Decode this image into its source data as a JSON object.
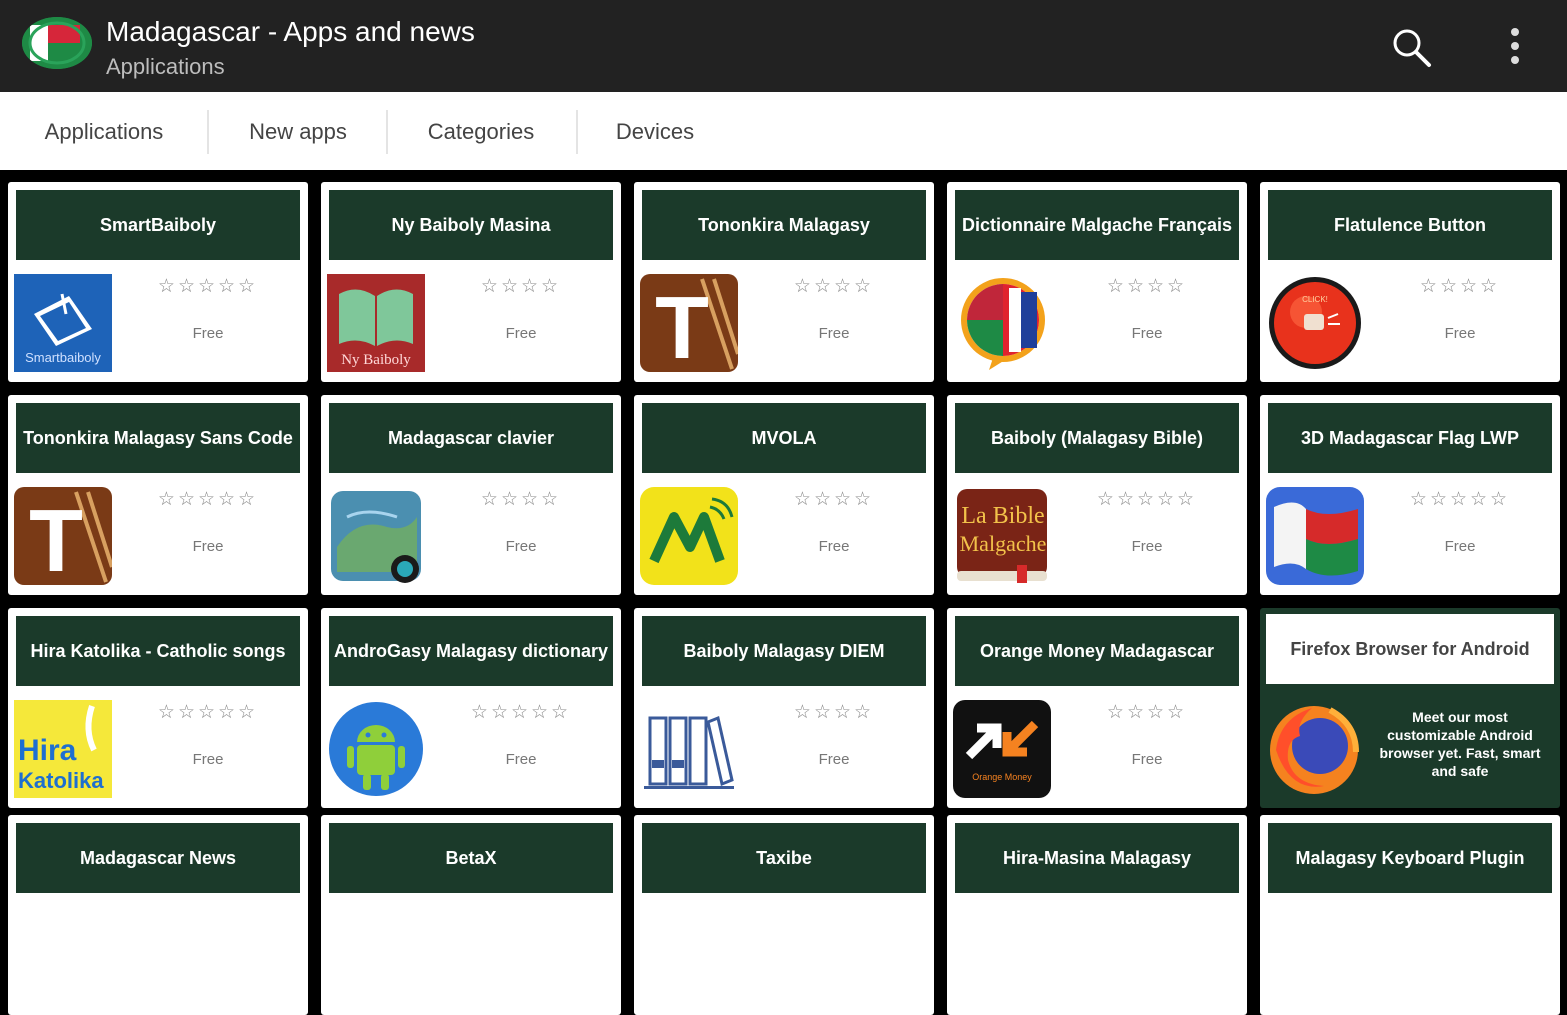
{
  "appbar": {
    "title": "Madagascar - Apps and news",
    "subtitle": "Applications",
    "logo_icon": "madagascar-flag-icon",
    "search_icon": "search-icon",
    "menu_icon": "more-vert-icon"
  },
  "tabs": [
    {
      "label": "Applications"
    },
    {
      "label": "New apps"
    },
    {
      "label": "Categories"
    },
    {
      "label": "Devices"
    }
  ],
  "apps": [
    {
      "name": "SmartBaiboly",
      "stars": "☆☆☆☆☆",
      "price": "Free",
      "icon": "smartbaiboly-icon"
    },
    {
      "name": "Ny Baiboly Masina",
      "stars": "☆☆☆☆",
      "price": "Free",
      "icon": "ny-baiboly-icon"
    },
    {
      "name": "Tononkira Malagasy",
      "stars": "☆☆☆☆",
      "price": "Free",
      "icon": "tononkira-icon"
    },
    {
      "name": "Dictionnaire Malgache Français",
      "stars": "☆☆☆☆",
      "price": "Free",
      "icon": "dictionary-flag-icon"
    },
    {
      "name": "Flatulence Button",
      "stars": "☆☆☆☆",
      "price": "Free",
      "icon": "red-button-icon"
    },
    {
      "name": "Tononkira Malagasy Sans Code",
      "stars": "☆☆☆☆☆",
      "price": "Free",
      "icon": "tononkira-icon"
    },
    {
      "name": "Madagascar clavier",
      "stars": "☆☆☆☆",
      "price": "Free",
      "icon": "keyboard-icon"
    },
    {
      "name": "MVOLA",
      "stars": "☆☆☆☆",
      "price": "Free",
      "icon": "mvola-icon"
    },
    {
      "name": "Baiboly (Malagasy Bible)",
      "stars": "☆☆☆☆☆",
      "price": "Free",
      "icon": "la-bible-icon"
    },
    {
      "name": "3D Madagascar Flag LWP",
      "stars": "☆☆☆☆☆",
      "price": "Free",
      "icon": "flag-3d-icon"
    },
    {
      "name": "Hira Katolika - Catholic songs",
      "stars": "☆☆☆☆☆",
      "price": "Free",
      "icon": "hira-katolika-icon"
    },
    {
      "name": "AndroGasy Malagasy dictionary",
      "stars": "☆☆☆☆☆",
      "price": "Free",
      "icon": "android-icon"
    },
    {
      "name": "Baiboly Malagasy DIEM",
      "stars": "☆☆☆☆",
      "price": "Free",
      "icon": "books-icon"
    },
    {
      "name": "Orange Money Madagascar",
      "stars": "☆☆☆☆",
      "price": "Free",
      "icon": "orange-money-icon"
    },
    {
      "name": "Madagascar News",
      "stars": "",
      "price": "",
      "icon": ""
    },
    {
      "name": "BetaX",
      "stars": "",
      "price": "",
      "icon": ""
    },
    {
      "name": "Taxibe",
      "stars": "",
      "price": "",
      "icon": ""
    },
    {
      "name": "Hira-Masina Malagasy",
      "stars": "",
      "price": "",
      "icon": ""
    },
    {
      "name": "Malagasy Keyboard Plugin",
      "stars": "",
      "price": "",
      "icon": ""
    }
  ],
  "ad": {
    "title": "Firefox Browser for Android",
    "text": "Meet our most customizable Android browser yet. Fast, smart and safe",
    "icon": "firefox-icon"
  },
  "icon_text": {
    "smartbaiboly": "Smartbaiboly",
    "ny_baiboly": "Ny Baiboly",
    "tononkira_letter": "T",
    "la_bible_1": "La Bible",
    "la_bible_2": "Malgache",
    "hira_1": "Hira",
    "hira_2": "Katolika",
    "orange_money": "Orange Money",
    "red_button": "CLICK!"
  },
  "colors": {
    "appbar": "#222222",
    "card_header": "#1b3a2a",
    "background": "#000000"
  }
}
